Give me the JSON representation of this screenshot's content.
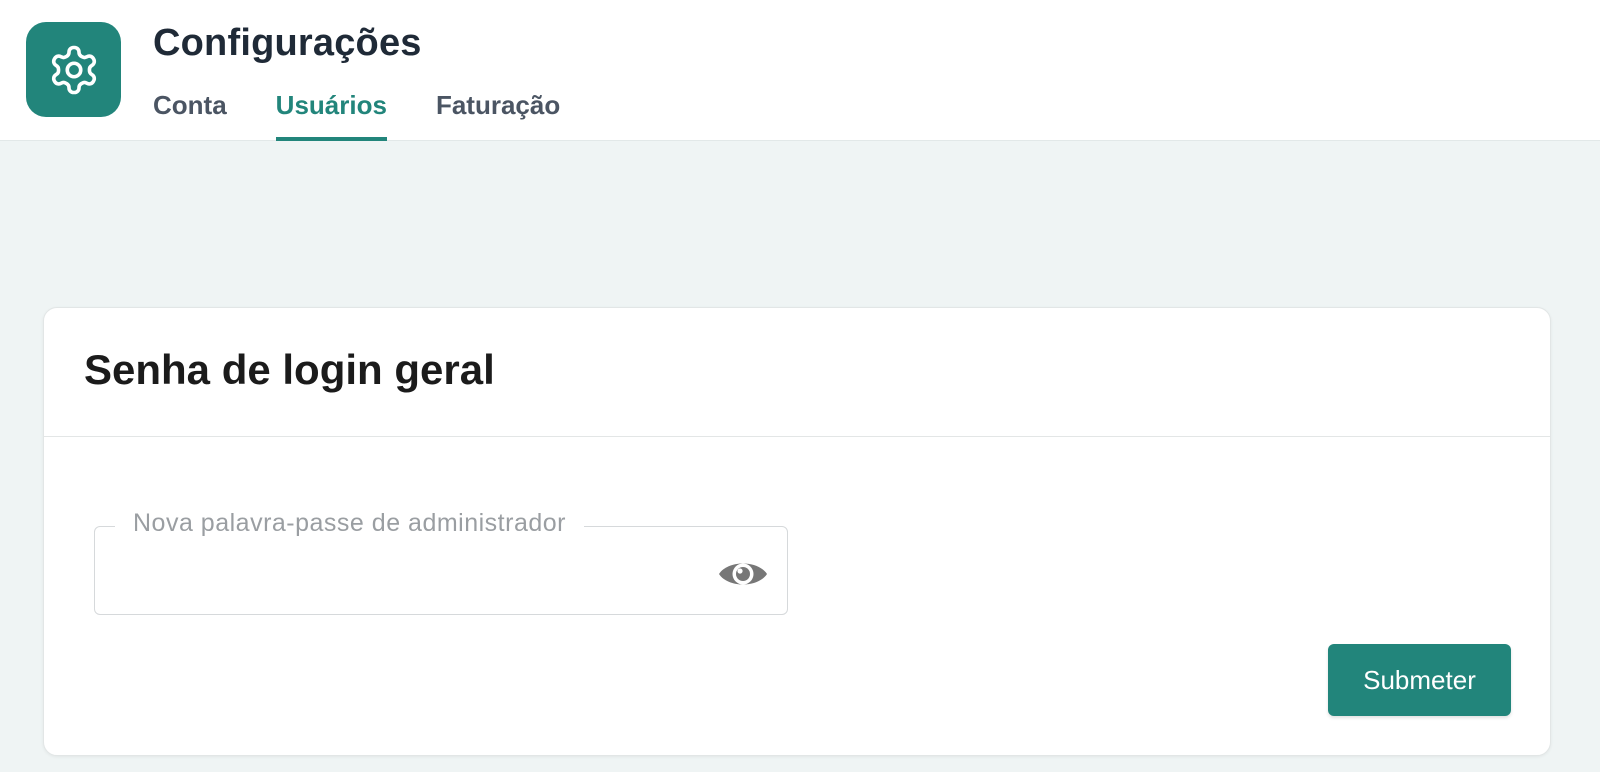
{
  "header": {
    "title": "Configurações",
    "app_icon": "gear-icon",
    "tabs": [
      {
        "label": "Conta",
        "active": false
      },
      {
        "label": "Usuários",
        "active": true
      },
      {
        "label": "Faturação",
        "active": false
      }
    ]
  },
  "card": {
    "title": "Senha de login geral",
    "password_field": {
      "label": "Nova palavra-passe de administrador",
      "value": "",
      "toggle_icon": "eye-icon"
    },
    "submit_label": "Submeter"
  },
  "colors": {
    "accent": "#22857b",
    "page_background": "#eff4f4"
  }
}
